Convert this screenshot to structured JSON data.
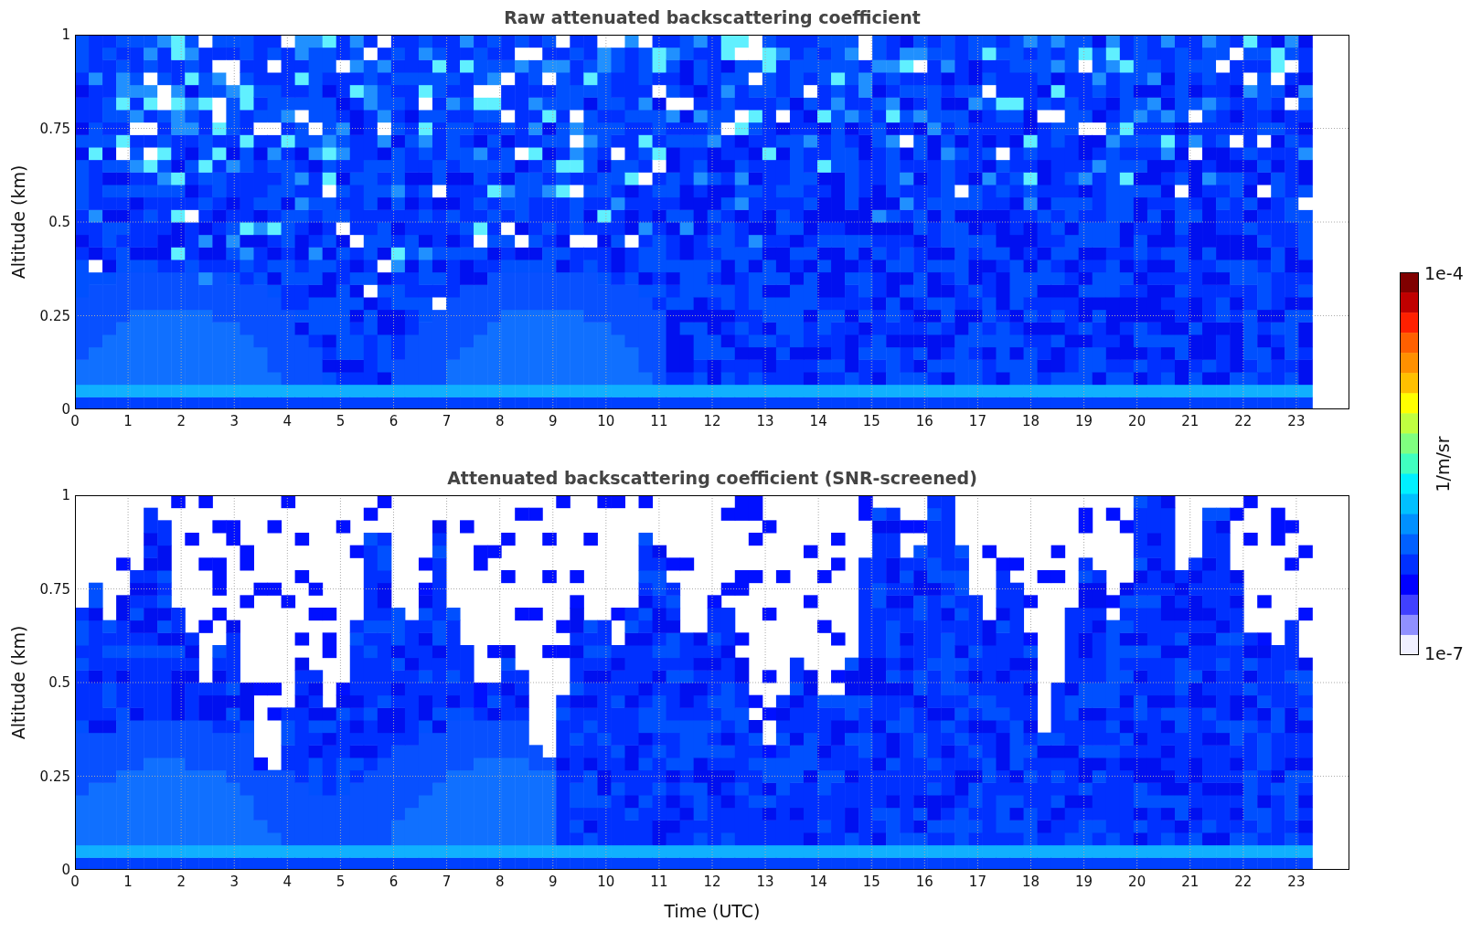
{
  "panels": [
    {
      "title": "Raw attenuated backscattering coefficient",
      "ylabel": "Altitude (km)",
      "screened": false,
      "yticks": [
        "1",
        "0.75",
        "0.5",
        "0.25",
        "0"
      ],
      "xticks": [
        "0",
        "1",
        "2",
        "3",
        "4",
        "5",
        "6",
        "7",
        "8",
        "9",
        "10",
        "11",
        "12",
        "13",
        "14",
        "15",
        "16",
        "17",
        "18",
        "19",
        "20",
        "21",
        "22",
        "23"
      ]
    },
    {
      "title": "Attenuated backscattering coefficient (SNR-screened)",
      "ylabel": "Altitude (km)",
      "screened": true,
      "yticks": [
        "1",
        "0.75",
        "0.5",
        "0.25",
        "0"
      ],
      "xticks": [
        "0",
        "1",
        "2",
        "3",
        "4",
        "5",
        "6",
        "7",
        "8",
        "9",
        "10",
        "11",
        "12",
        "13",
        "14",
        "15",
        "16",
        "17",
        "18",
        "19",
        "20",
        "21",
        "22",
        "23"
      ]
    }
  ],
  "xlabel": "Time (UTC)",
  "colorbar": {
    "max_label": "1e-4",
    "min_label": "1e-7",
    "unit": "1/m/sr"
  }
}
